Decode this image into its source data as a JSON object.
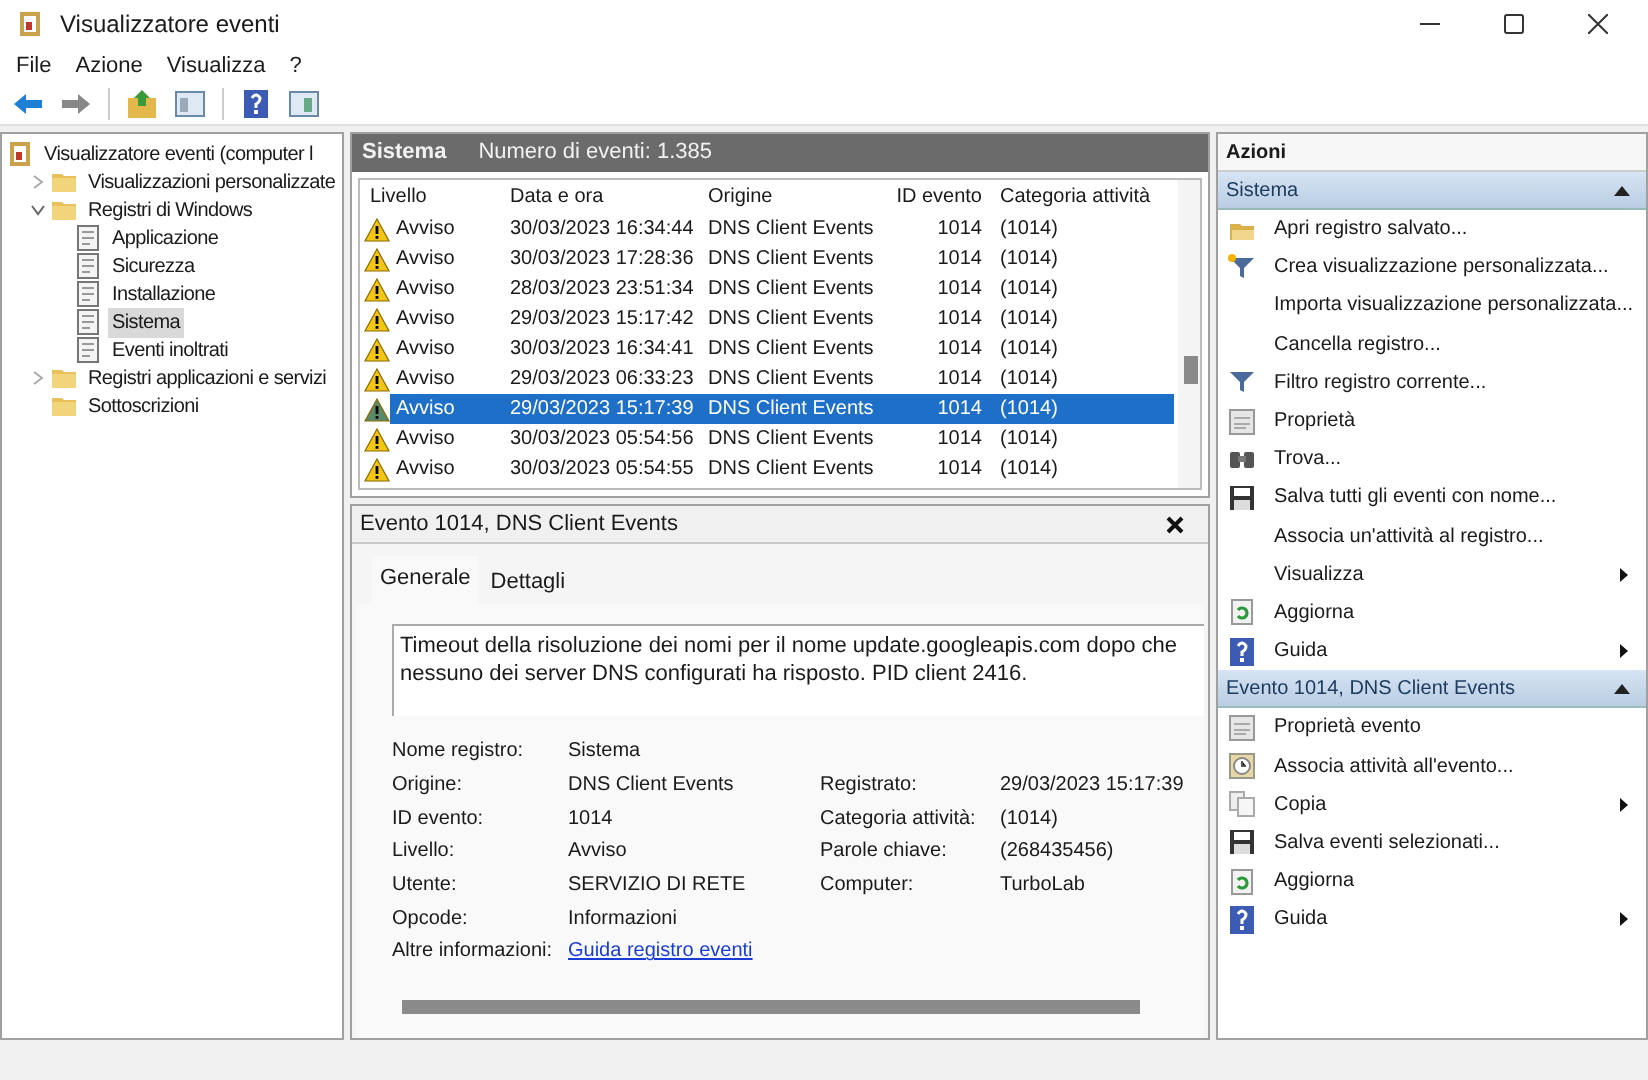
{
  "window": {
    "title": "Visualizzatore eventi"
  },
  "menu": [
    "File",
    "Azione",
    "Visualizza",
    "?"
  ],
  "toolbar": [
    {
      "kind": "back"
    },
    {
      "kind": "forward"
    },
    {
      "kind": "up"
    },
    {
      "kind": "pane"
    },
    {
      "kind": "help"
    },
    {
      "kind": "pane2"
    }
  ],
  "tree": [
    {
      "label": "Visualizzatore eventi (computer l",
      "kind": "viewer",
      "selected": false,
      "children": [
        {
          "label": "Visualizzazioni personalizzate",
          "kind": "folder",
          "expanded": false,
          "selected": false
        },
        {
          "label": "Registri di Windows",
          "kind": "folder",
          "expanded": true,
          "selected": false,
          "children": [
            {
              "label": "Applicazione",
              "kind": "log",
              "selected": false
            },
            {
              "label": "Sicurezza",
              "kind": "log",
              "selected": false
            },
            {
              "label": "Installazione",
              "kind": "log",
              "selected": false
            },
            {
              "label": "Sistema",
              "kind": "log",
              "selected": true
            },
            {
              "label": "Eventi inoltrati",
              "kind": "log",
              "selected": false
            }
          ]
        },
        {
          "label": "Registri applicazioni e servizi",
          "kind": "folder",
          "expanded": false,
          "selected": false
        },
        {
          "label": "Sottoscrizioni",
          "kind": "folder",
          "selected": false
        }
      ]
    }
  ],
  "log_header": {
    "name": "Sistema",
    "count": "Numero di eventi: 1.385"
  },
  "events": {
    "columns": [
      "Livello",
      "Data e ora",
      "Origine",
      "ID evento",
      "Categoria attività"
    ],
    "rows": [
      {
        "level": "Avviso",
        "datetime": "30/03/2023 16:34:44",
        "source": "DNS Client Events",
        "id": "1014",
        "category": "(1014)",
        "selected": false
      },
      {
        "level": "Avviso",
        "datetime": "30/03/2023 17:28:36",
        "source": "DNS Client Events",
        "id": "1014",
        "category": "(1014)",
        "selected": false
      },
      {
        "level": "Avviso",
        "datetime": "28/03/2023 23:51:34",
        "source": "DNS Client Events",
        "id": "1014",
        "category": "(1014)",
        "selected": false
      },
      {
        "level": "Avviso",
        "datetime": "29/03/2023 15:17:42",
        "source": "DNS Client Events",
        "id": "1014",
        "category": "(1014)",
        "selected": false
      },
      {
        "level": "Avviso",
        "datetime": "30/03/2023 16:34:41",
        "source": "DNS Client Events",
        "id": "1014",
        "category": "(1014)",
        "selected": false
      },
      {
        "level": "Avviso",
        "datetime": "29/03/2023 06:33:23",
        "source": "DNS Client Events",
        "id": "1014",
        "category": "(1014)",
        "selected": false
      },
      {
        "level": "Avviso",
        "datetime": "29/03/2023 15:17:39",
        "source": "DNS Client Events",
        "id": "1014",
        "category": "(1014)",
        "selected": true
      },
      {
        "level": "Avviso",
        "datetime": "30/03/2023 05:54:56",
        "source": "DNS Client Events",
        "id": "1014",
        "category": "(1014)",
        "selected": false
      },
      {
        "level": "Avviso",
        "datetime": "30/03/2023 05:54:55",
        "source": "DNS Client Events",
        "id": "1014",
        "category": "(1014)",
        "selected": false
      }
    ]
  },
  "detail": {
    "title": "Evento 1014, DNS Client Events",
    "tabs": [
      {
        "label": "Generale",
        "selected": true
      },
      {
        "label": "Dettagli",
        "selected": false
      }
    ],
    "message": "Timeout della risoluzione dei nomi per il nome update.googleapis.com dopo che nessuno dei server DNS configurati ha risposto. PID client 2416.",
    "fields_left": [
      {
        "label": "Nome registro:",
        "value": "Sistema"
      },
      {
        "label": "Origine:",
        "value": "DNS Client Events"
      },
      {
        "label": "ID evento:",
        "value": "1014"
      },
      {
        "label": "Livello:",
        "value": "Avviso"
      },
      {
        "label": "Utente:",
        "value": "SERVIZIO DI RETE"
      },
      {
        "label": "Opcode:",
        "value": "Informazioni"
      },
      {
        "label": "Altre informazioni:",
        "value": "Guida registro eventi",
        "kind": "link"
      }
    ],
    "fields_right": [
      {
        "label": "Registrato:",
        "value": "29/03/2023 15:17:39"
      },
      {
        "label": "Categoria attività:",
        "value": "(1014)"
      },
      {
        "label": "Parole chiave:",
        "value": "(268435456)"
      },
      {
        "label": "Computer:",
        "value": "TurboLab"
      }
    ]
  },
  "actions": {
    "title": "Azioni",
    "sections": [
      {
        "title": "Sistema",
        "expanded": true,
        "items": [
          {
            "label": "Apri registro salvato...",
            "kind": "open"
          },
          {
            "label": "Crea visualizzazione personalizzata...",
            "kind": "filter-new"
          },
          {
            "label": "Importa visualizzazione personalizzata...",
            "kind": "plain"
          },
          {
            "label": "Cancella registro...",
            "kind": "plain"
          },
          {
            "label": "Filtro registro corrente...",
            "kind": "filter"
          },
          {
            "label": "Proprietà",
            "kind": "props"
          },
          {
            "label": "Trova...",
            "kind": "find"
          },
          {
            "label": "Salva tutti gli eventi con nome...",
            "kind": "save"
          },
          {
            "label": "Associa un'attività al registro...",
            "kind": "plain"
          },
          {
            "label": "Visualizza",
            "kind": "plain",
            "submenu": true
          },
          {
            "label": "Aggiorna",
            "kind": "refresh"
          },
          {
            "label": "Guida",
            "kind": "help",
            "submenu": true
          }
        ]
      },
      {
        "title": "Evento 1014, DNS Client Events",
        "expanded": true,
        "items": [
          {
            "label": "Proprietà evento",
            "kind": "props"
          },
          {
            "label": "Associa attività all'evento...",
            "kind": "task"
          },
          {
            "label": "Copia",
            "kind": "copy",
            "submenu": true
          },
          {
            "label": "Salva eventi selezionati...",
            "kind": "save"
          },
          {
            "label": "Aggiorna",
            "kind": "refresh"
          },
          {
            "label": "Guida",
            "kind": "help",
            "submenu": true
          }
        ]
      }
    ]
  }
}
